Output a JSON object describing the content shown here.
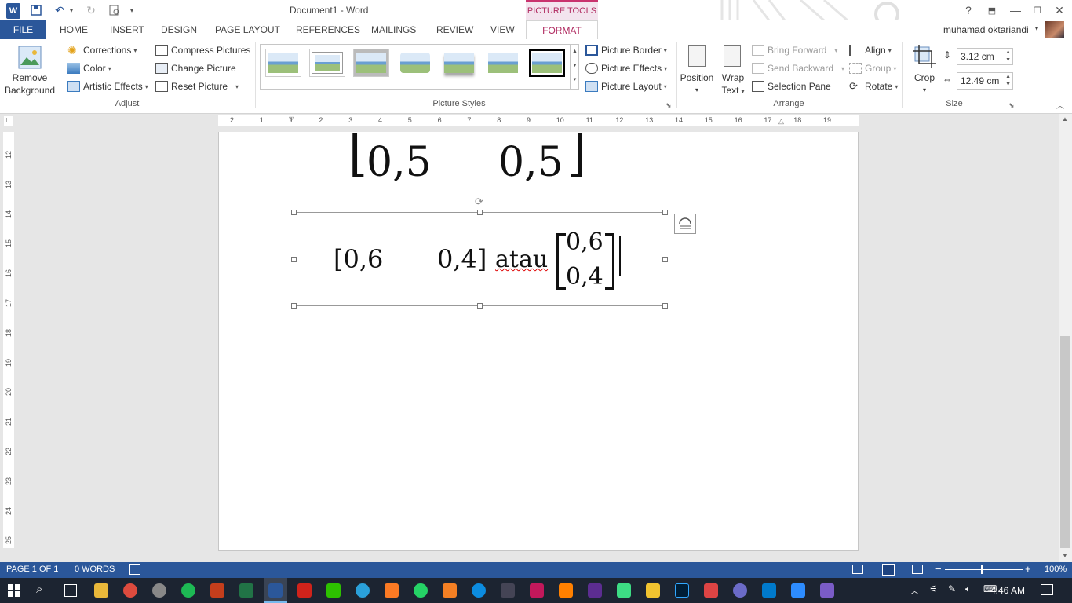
{
  "titlebar": {
    "title": "Document1 - Word",
    "help": "?",
    "contextual_tab_group": "PICTURE TOOLS"
  },
  "tabs": [
    "FILE",
    "HOME",
    "INSERT",
    "DESIGN",
    "PAGE LAYOUT",
    "REFERENCES",
    "MAILINGS",
    "REVIEW",
    "VIEW",
    "FORMAT"
  ],
  "user": {
    "name": "muhamad oktariandi"
  },
  "ribbon": {
    "adjust": {
      "remove_background_line1": "Remove",
      "remove_background_line2": "Background",
      "corrections": "Corrections",
      "color": "Color",
      "artistic_effects": "Artistic Effects",
      "compress_pictures": "Compress Pictures",
      "change_picture": "Change Picture",
      "reset_picture": "Reset Picture",
      "label": "Adjust"
    },
    "picture_styles": {
      "picture_border": "Picture Border",
      "picture_effects": "Picture Effects",
      "picture_layout": "Picture Layout",
      "label": "Picture Styles"
    },
    "arrange": {
      "position": "Position",
      "wrap_text_line1": "Wrap",
      "wrap_text_line2": "Text",
      "bring_forward": "Bring Forward",
      "send_backward": "Send Backward",
      "selection_pane": "Selection Pane",
      "align": "Align",
      "group": "Group",
      "rotate": "Rotate",
      "label": "Arrange"
    },
    "size": {
      "crop": "Crop",
      "height": "3.12 cm",
      "width": "12.49 cm",
      "label": "Size"
    }
  },
  "hruler_numbers": [
    "2",
    "1",
    "1",
    "2",
    "3",
    "4",
    "5",
    "6",
    "7",
    "8",
    "9",
    "10",
    "11",
    "12",
    "13",
    "14",
    "15",
    "16",
    "17",
    "18",
    "19"
  ],
  "vruler_numbers": [
    "12",
    "13",
    "14",
    "15",
    "16",
    "17",
    "18",
    "19",
    "20",
    "21",
    "22",
    "23",
    "24",
    "25"
  ],
  "document": {
    "top_image": {
      "left_bracket": "⌊",
      "value1": "0,5",
      "value2": "0,5",
      "right_bracket": "⌋"
    },
    "selected_image": {
      "row_open": "[0,6",
      "row_close": "0,4]",
      "word": "atau",
      "col_top": "0,6",
      "col_bottom": "0,4"
    }
  },
  "statusbar": {
    "page": "PAGE 1 OF 1",
    "words": "0 WORDS",
    "zoom": "100%"
  },
  "taskbar": {
    "time": "4:46 AM"
  }
}
